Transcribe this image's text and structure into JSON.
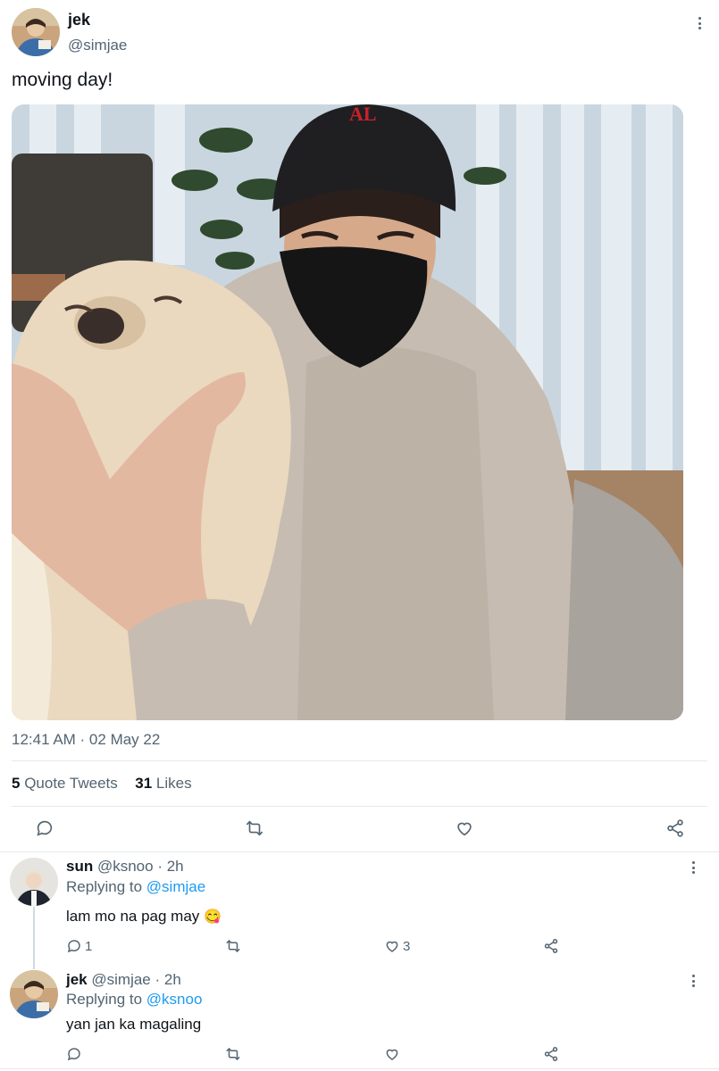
{
  "tweet": {
    "name": "jek",
    "handle": "@simjae",
    "text": "moving day!",
    "timestamp": "12:41 AM · 02 May 22",
    "stats": {
      "quote_count": "5",
      "quote_label": "Quote Tweets",
      "like_count": "31",
      "like_label": "Likes"
    },
    "actions": [
      "reply-icon",
      "retweet-icon",
      "like-icon",
      "share-icon"
    ]
  },
  "replies": [
    {
      "name": "sun",
      "handle": "@ksnoo",
      "time": "· 2h",
      "replying_prefix": "Replying to",
      "replying_to": "@simjae",
      "text": "lam mo na pag may",
      "emoji": "😋",
      "reply_count": "1",
      "retweet_count": "",
      "like_count": "3"
    },
    {
      "name": "jek",
      "handle": "@simjae",
      "time": "· 2h",
      "replying_prefix": "Replying to",
      "replying_to": "@ksnoo",
      "text": "yan jan ka magaling",
      "reply_count": "",
      "retweet_count": "",
      "like_count": ""
    }
  ],
  "colors": {
    "accent": "#1d9bf0",
    "text": "#0f1419",
    "muted": "#536471",
    "divider": "#e7e9ea"
  }
}
